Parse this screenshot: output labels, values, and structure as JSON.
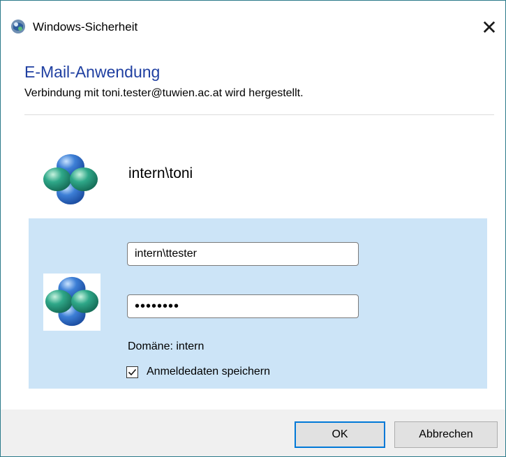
{
  "window": {
    "title": "Windows-Sicherheit",
    "close_symbol": "✕",
    "app_icon": "security-shield-icon"
  },
  "header": {
    "heading": "E-Mail-Anwendung",
    "subheading": "Verbindung mit toni.tester@tuwien.ac.at wird hergestellt."
  },
  "user_tile": {
    "name": "intern\\toni",
    "icon": "user-avatar-icon"
  },
  "credentials": {
    "icon": "user-avatar-icon",
    "username": "intern\\ttester",
    "password_mask": "••••••••",
    "domain_label": "Domäne: intern",
    "remember_label": "Anmeldedaten speichern",
    "remember_checked": true
  },
  "footer": {
    "ok_label": "OK",
    "cancel_label": "Abbrechen"
  },
  "colors": {
    "heading": "#1f3fa1",
    "panel": "#cce4f7",
    "default_button_border": "#0078d7",
    "window_border": "#2b7a8a"
  }
}
